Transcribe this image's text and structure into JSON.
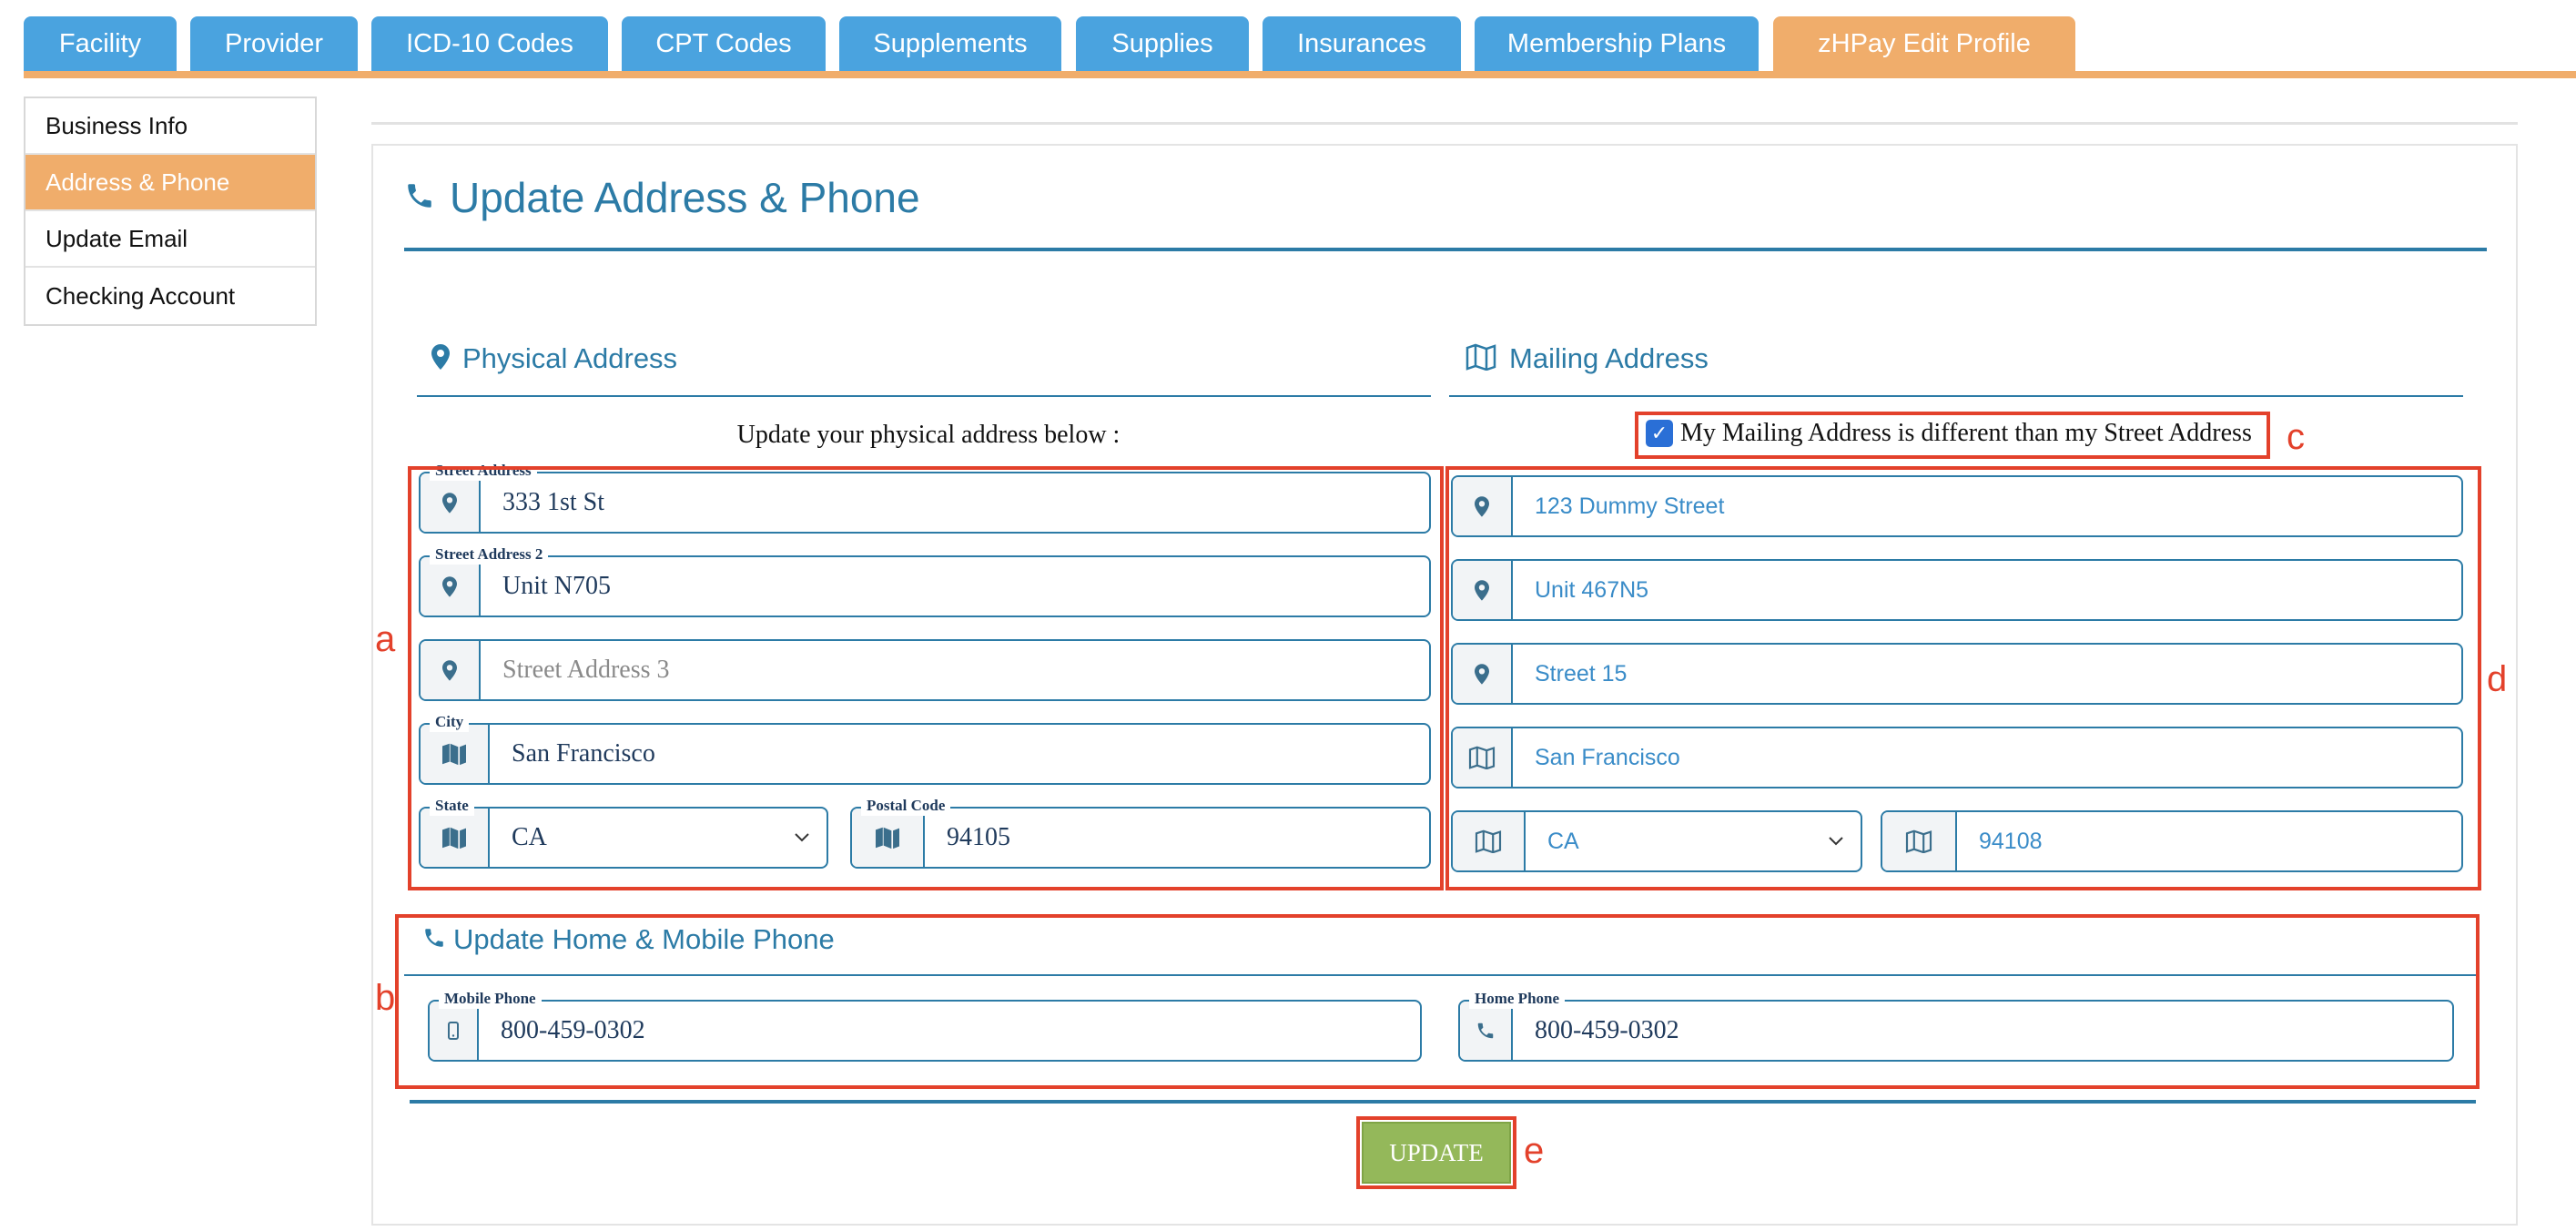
{
  "tabs": [
    {
      "label": "Facility",
      "active": false
    },
    {
      "label": "Provider",
      "active": false
    },
    {
      "label": "ICD-10 Codes",
      "active": false
    },
    {
      "label": "CPT Codes",
      "active": false
    },
    {
      "label": "Supplements",
      "active": false
    },
    {
      "label": "Supplies",
      "active": false
    },
    {
      "label": "Insurances",
      "active": false
    },
    {
      "label": "Membership Plans",
      "active": false
    },
    {
      "label": "zHPay Edit Profile",
      "active": true
    }
  ],
  "sidebar": {
    "items": [
      {
        "label": "Business Info",
        "active": false
      },
      {
        "label": "Address & Phone",
        "active": true
      },
      {
        "label": "Update Email",
        "active": false
      },
      {
        "label": "Checking Account",
        "active": false
      }
    ]
  },
  "page": {
    "title": "Update Address & Phone"
  },
  "physical": {
    "heading": "Physical Address",
    "instruction": "Update your physical address below :",
    "street1": {
      "label": "Street Address",
      "value": "333 1st St"
    },
    "street2": {
      "label": "Street Address 2",
      "value": "Unit N705"
    },
    "street3": {
      "label": "",
      "placeholder": "Street Address 3"
    },
    "city": {
      "label": "City",
      "value": "San Francisco"
    },
    "state": {
      "label": "State",
      "value": "CA"
    },
    "postal": {
      "label": "Postal Code",
      "value": "94105"
    }
  },
  "mailing": {
    "heading": "Mailing Address",
    "checkbox_label": "My Mailing Address is different than my Street Address",
    "checkbox_checked": true,
    "street1": "123 Dummy Street",
    "street2": "Unit 467N5",
    "street3": "Street 15",
    "city": "San Francisco",
    "state": "CA",
    "postal": "94108"
  },
  "phone": {
    "heading": "Update Home & Mobile Phone",
    "mobile": {
      "label": "Mobile Phone",
      "value": "800-459-0302"
    },
    "home": {
      "label": "Home Phone",
      "value": "800-459-0302"
    }
  },
  "update_button": "UPDATE",
  "annotations": {
    "a": "a",
    "b": "b",
    "c": "c",
    "d": "d",
    "e": "e"
  },
  "colors": {
    "tab_blue": "#4aa3df",
    "tab_active": "#f0ad6b",
    "accent_blue": "#2c7ba6",
    "annotation_red": "#e3412b",
    "update_green": "#94b85a"
  },
  "icons": {
    "phone": "phone-icon",
    "map_marker": "map-marker-icon",
    "map": "map-icon",
    "mobile": "mobile-icon",
    "chevron": "chevron-down-icon"
  }
}
